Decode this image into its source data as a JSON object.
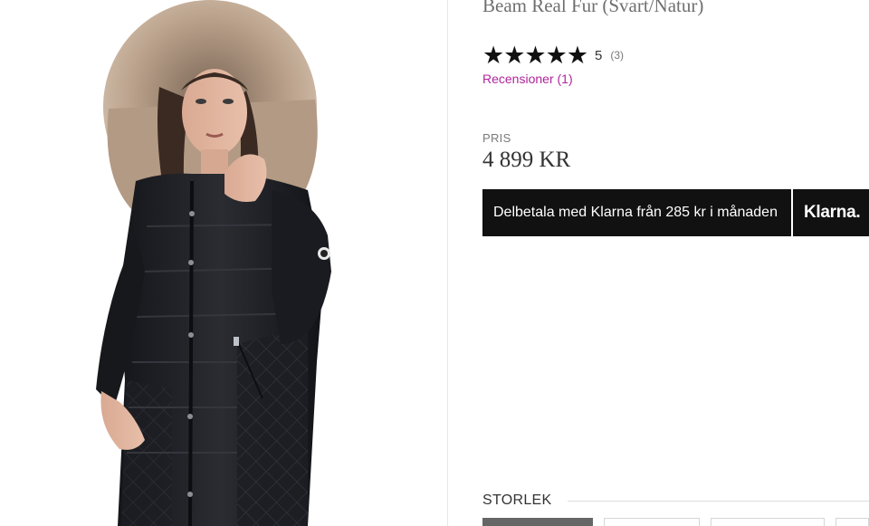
{
  "product": {
    "title": "Beam Real Fur (Svart/Natur)",
    "image_alt": "Woman wearing black quilted down coat with natural fur hood"
  },
  "rating": {
    "stars": "★★★★★",
    "value": "5",
    "count": "(3)",
    "reviews_link": "Recensioner (1)"
  },
  "price": {
    "label": "PRIS",
    "value": "4 899 KR"
  },
  "klarna": {
    "text": "Delbetala med Klarna från 285 kr i månaden",
    "logo": "Klarna."
  },
  "size": {
    "label": "STORLEK",
    "options": [
      "",
      "",
      "",
      ""
    ]
  },
  "colors": {
    "accent_link": "#b0259c",
    "klarna_bg": "#111111",
    "coat": "#1b1c20",
    "fur": "#b9a08a"
  }
}
